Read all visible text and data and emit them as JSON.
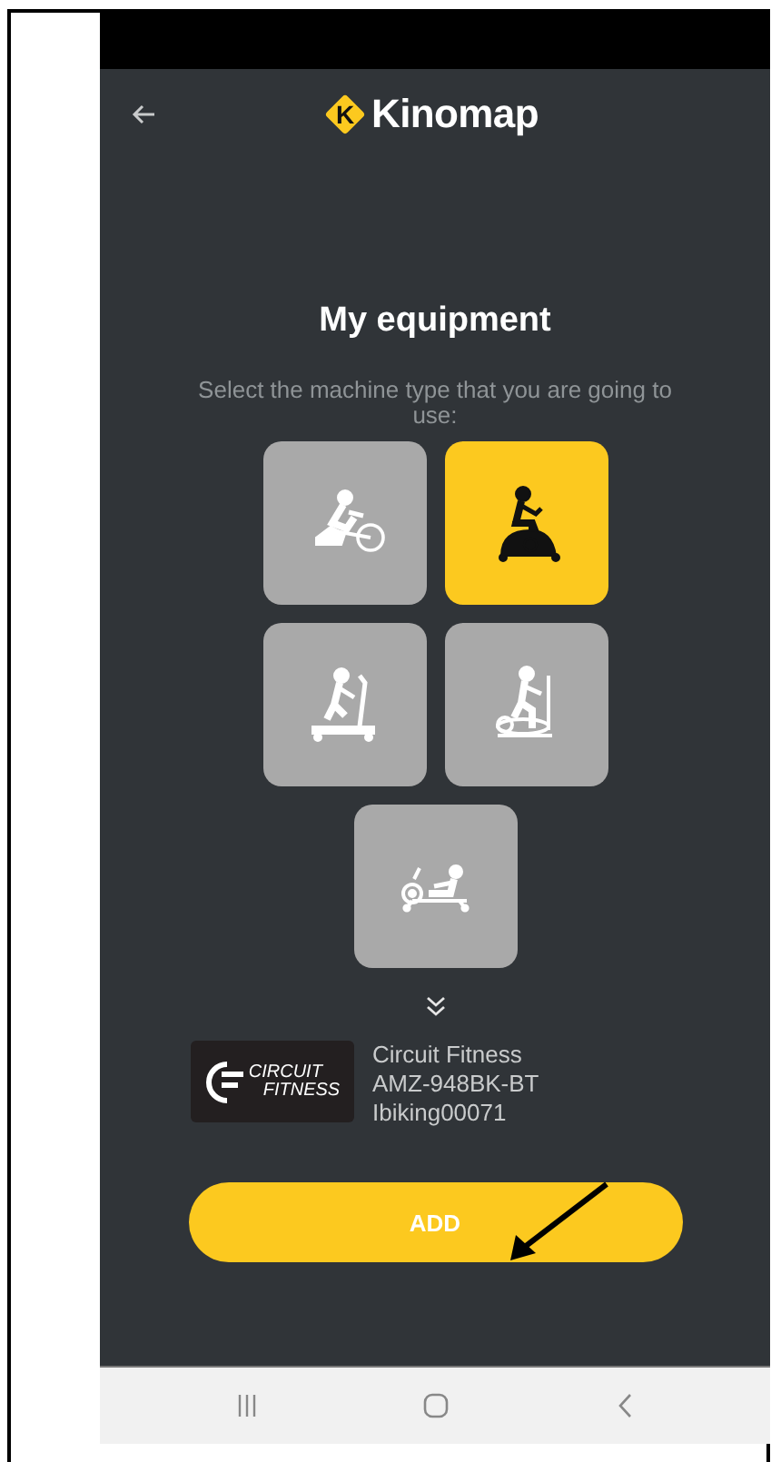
{
  "app_bar": {
    "logo_mark": "K",
    "logo_text": "Kinomap"
  },
  "title": "My equipment",
  "subtitle": "Select the machine type that you are going to use:",
  "machines": [
    {
      "kind": "bike",
      "selected": false
    },
    {
      "kind": "exercise-bike",
      "selected": true
    },
    {
      "kind": "treadmill",
      "selected": false
    },
    {
      "kind": "elliptical",
      "selected": false
    },
    {
      "kind": "rower",
      "selected": false
    }
  ],
  "device": {
    "logo_lines": [
      "CIRCUIT",
      "FITNESS"
    ],
    "lines": [
      "Circuit Fitness",
      "AMZ-948BK-BT",
      "Ibiking00071"
    ]
  },
  "add_button": "ADD"
}
